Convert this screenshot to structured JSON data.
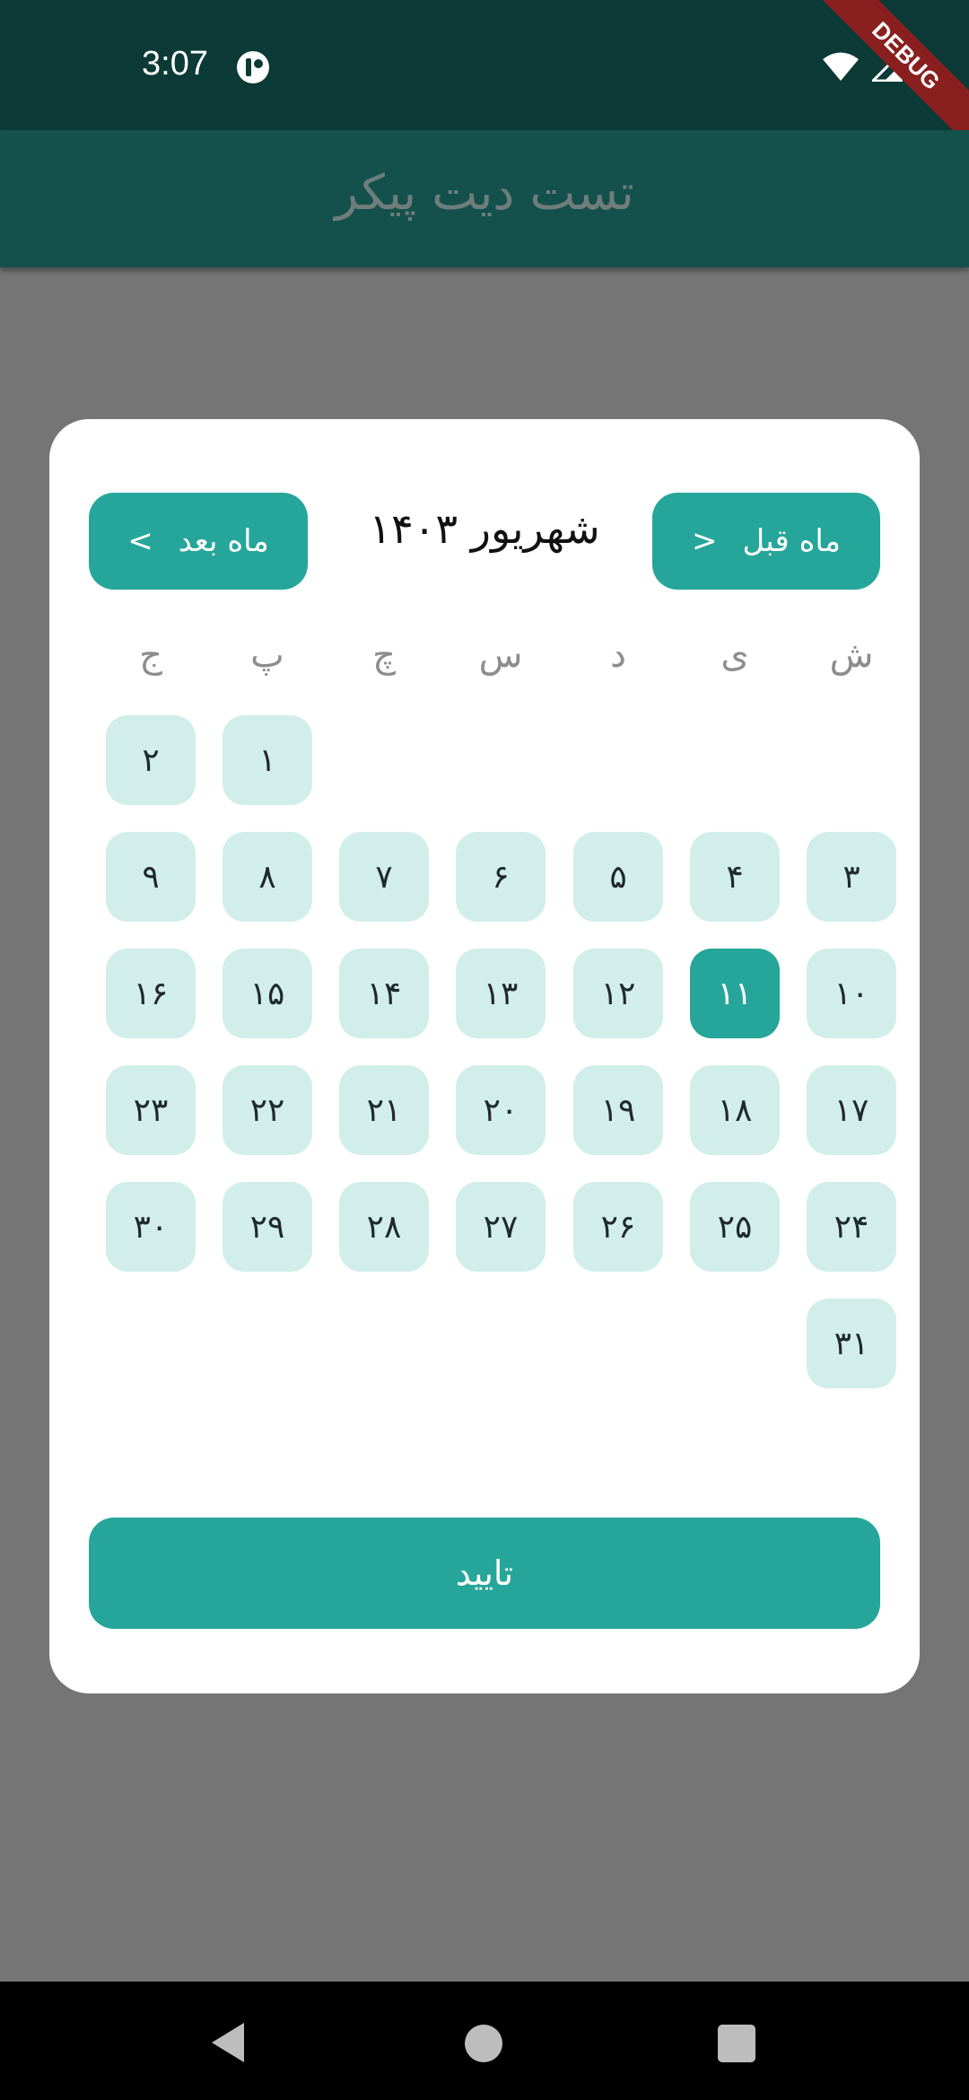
{
  "status_bar": {
    "time": "3:07",
    "debug_banner": "DEBUG"
  },
  "app_bar": {
    "title": "تست دیت پیکر"
  },
  "date_picker": {
    "month_title": "شهریور ۱۴۰۳",
    "prev_month_label": "ماه قبل",
    "prev_month_arrow": "<",
    "next_month_label": "ماه بعد",
    "next_month_arrow": ">",
    "weekdays": [
      "ش",
      "ی",
      "د",
      "س",
      "چ",
      "پ",
      "ج"
    ],
    "days": [
      "۱",
      "۲",
      "۳",
      "۴",
      "۵",
      "۶",
      "۷",
      "۸",
      "۹",
      "۱۰",
      "۱۱",
      "۱۲",
      "۱۳",
      "۱۴",
      "۱۵",
      "۱۶",
      "۱۷",
      "۱۸",
      "۱۹",
      "۲۰",
      "۲۱",
      "۲۲",
      "۲۳",
      "۲۴",
      "۲۵",
      "۲۶",
      "۲۷",
      "۲۸",
      "۲۹",
      "۳۰",
      "۳۱"
    ],
    "first_day_column": 5,
    "selected_day": "۱۱",
    "confirm_label": "تایید"
  },
  "colors": {
    "accent": "#26a69a",
    "day_bg": "#d1eeeb",
    "app_bar": "#14514d",
    "status_bar": "#0c3a36",
    "scrim": "#757575"
  }
}
